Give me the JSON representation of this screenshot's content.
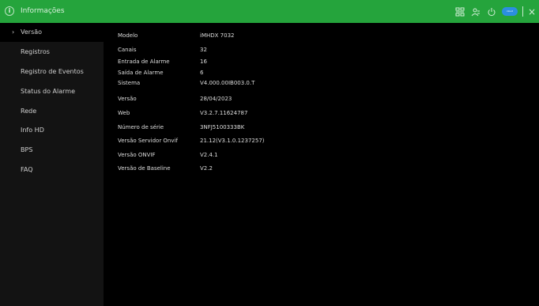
{
  "header": {
    "title": "Informações",
    "accent_color": "#25a43c",
    "cloud_badge": "cloud",
    "close_label": "×"
  },
  "sidebar": {
    "items": [
      {
        "label": "Versão",
        "active": true
      },
      {
        "label": "Registros",
        "active": false
      },
      {
        "label": "Registro de Eventos",
        "active": false
      },
      {
        "label": "Status do Alarme",
        "active": false
      },
      {
        "label": "Rede",
        "active": false
      },
      {
        "label": "Info HD",
        "active": false
      },
      {
        "label": "BPS",
        "active": false
      },
      {
        "label": "FAQ",
        "active": false
      }
    ]
  },
  "version_info": [
    {
      "label": "Modelo",
      "value": "iMHDX 7032"
    },
    {
      "label": "Canais",
      "value": "32"
    },
    {
      "label": "Entrada de Alarme",
      "value": "16"
    },
    {
      "label": "Saída de Alarme",
      "value": "6"
    },
    {
      "label": "Sistema",
      "value": "V4.000.00IB003.0.T"
    },
    {
      "label": "Versão",
      "value": "28/04/2023"
    },
    {
      "label": "Web",
      "value": "V3.2.7.11624787"
    },
    {
      "label": "Número de série",
      "value": "3NFJ5100333BK"
    },
    {
      "label": "Versão Servidor Onvif",
      "value": "21.12(V3.1.0.1237257)"
    },
    {
      "label": "Versão ONVIF",
      "value": "V2.4.1"
    },
    {
      "label": "Versão de Baseline",
      "value": "V2.2"
    }
  ],
  "icons": [
    "info-icon",
    "network-icon",
    "users-icon",
    "power-icon",
    "cloud-icon",
    "close-icon"
  ]
}
